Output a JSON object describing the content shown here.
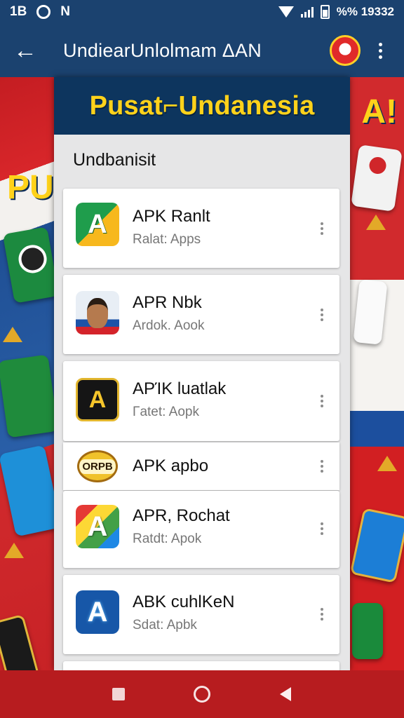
{
  "status_bar": {
    "left_text": "1B",
    "right_text": "%% 19332",
    "icons": [
      "circle-icon",
      "notification-n-icon",
      "wifi-icon",
      "signal-icon",
      "battery-icon"
    ]
  },
  "app_bar": {
    "title": "UndiearUnlolmam ΔΑΝ",
    "back_icon": "arrow-left-icon",
    "mascot_icon": "mascot-icon",
    "menu_icon": "more-vertical-icon"
  },
  "background": {
    "left_text": "PU",
    "right_text": "A!"
  },
  "banner": {
    "title": "Pusat⌐Undanesia"
  },
  "section": {
    "title": "Undbanisit"
  },
  "apps": [
    {
      "name": "APK Ranlt",
      "subtitle": "Ralat: Apps",
      "icon": "apk-arrow-icon",
      "icon_text": "A"
    },
    {
      "name": "APR Nbk",
      "subtitle": "Ardok. Aook",
      "icon": "person-portrait-icon",
      "icon_text": ""
    },
    {
      "name": "APΊK luatlak",
      "subtitle": "Γatet: Aopk",
      "icon": "black-gold-a-icon",
      "icon_text": "A"
    },
    {
      "name": "APK apbo",
      "subtitle": "",
      "icon": "orpb-coin-icon",
      "icon_text": "ORPB"
    },
    {
      "name": "APR, Rochat",
      "subtitle": "Ratdt: Apok",
      "icon": "rainbow-a-icon",
      "icon_text": "A"
    },
    {
      "name": "ABK cuhlKeN",
      "subtitle": "Sdat: Apbk",
      "icon": "blue-glow-a-icon",
      "icon_text": "A"
    }
  ],
  "nav_bar": {
    "buttons": [
      "recent-apps-icon",
      "home-icon",
      "back-icon"
    ]
  },
  "colors": {
    "app_bar": "#1b426f",
    "banner": "#0d355e",
    "banner_text": "#ffd21b",
    "nav_bar": "#b71c1f",
    "panel": "#e6e6e7"
  }
}
